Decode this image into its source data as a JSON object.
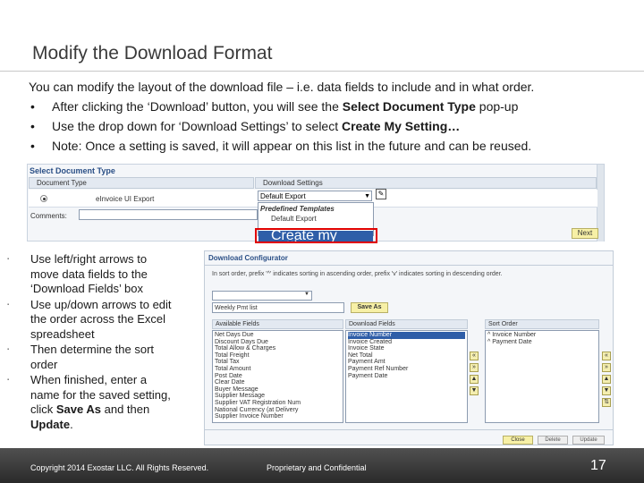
{
  "slide": {
    "title": "Modify the Download Format",
    "intro": "You can modify the layout of the download file – i.e. data fields to include and in what order.",
    "bullets": [
      {
        "before": "After clicking the ‘Download’ button, you will see the ",
        "bold": "Select Document Type",
        "after": " pop-up"
      },
      {
        "before": "Use the drop down for ‘Download Settings’ to select ",
        "bold": "Create My Setting…",
        "after": ""
      },
      {
        "before": "Note:  Once a setting is saved, it will appear on this list in the future and can be reused.",
        "bold": "",
        "after": ""
      }
    ],
    "bullet_char": "•",
    "left_bullets": [
      {
        "before": "Use left/right arrows to move data fields to the ‘Download Fields’ box",
        "b1": "",
        "mid": "",
        "b2": "",
        "end": ""
      },
      {
        "before": "Use up/down arrows to edit the order across the Excel spreadsheet",
        "b1": "",
        "mid": "",
        "b2": "",
        "end": ""
      },
      {
        "before": "Then determine the sort order",
        "b1": "",
        "mid": "",
        "b2": "",
        "end": ""
      },
      {
        "before": "When finished, enter a name for the saved setting, click ",
        "b1": "Save As",
        "mid": " and then ",
        "b2": "Update",
        "end": "."
      }
    ],
    "left_bullet_char": "▪"
  },
  "select_doc_popup": {
    "title": "Select Document Type",
    "col_doc_type": "Document Type",
    "col_download_settings": "Download Settings",
    "doc_type_value": "eInvoice UI Export",
    "download_select_value": "Default Export",
    "comments_label": "Comments:",
    "dropdown_group": "Predefined Templates",
    "dropdown_item": "Default Export",
    "dropdown_highlight": "Create my setting...",
    "next_button": "Next"
  },
  "download_config": {
    "title": "Download Configurator",
    "note": "In sort order, prefix '^' indicates sorting in ascending order, prefix 'v' indicates sorting in descending order.",
    "name_value": "Weekly Pmt list",
    "save_as_button": "Save As",
    "available_header": "Available Fields",
    "download_header": "Download Fields",
    "sort_header": "Sort Order",
    "available_fields": [
      "Net Days Due",
      "Discount Days Due",
      "Total Allow & Charges",
      "Total Freight",
      "Total Tax",
      "Total Amount",
      "Post Date",
      "Clear Date",
      "Buyer Message",
      "Supplier Message",
      "Supplier VAT Registration Num",
      "National Currency (at Delivery",
      "Supplier Invoice Number"
    ],
    "download_fields": [
      "Invoice Number",
      "Invoice Created",
      "Invoice State",
      "Net Total",
      "Payment Amt",
      "Payment Ref Number",
      "Payment Date"
    ],
    "sort_fields": [
      "^ Invoice Number",
      "^ Payment Date"
    ],
    "buttons": [
      "Close",
      "Delete",
      "Update"
    ]
  },
  "footer": {
    "copyright": "Copyright 2014 Exostar LLC. All Rights Reserved.",
    "proprietary": "Proprietary and Confidential",
    "page_number": "17"
  },
  "colors": {
    "highlight_box": "#e00000",
    "selection": "#2f5ea8",
    "button_yellow": "#f7f0a6",
    "footer_bg": "#3a3a3a"
  }
}
